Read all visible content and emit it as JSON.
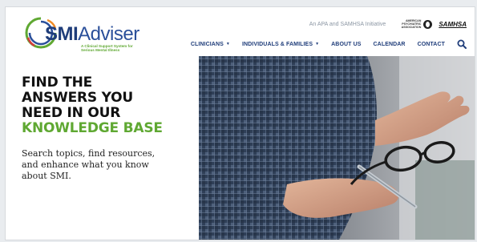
{
  "logo": {
    "smi": "SMI",
    "adviser": "Adviser",
    "tagline": "A Clinical Support System for Serious Mental Illness"
  },
  "header": {
    "initiative": "An APA and SAMHSA Initiative",
    "apa_text": "AMERICAN PSYCHIATRIC ASSOCIATION",
    "samhsa": "SAMHSA"
  },
  "nav": {
    "items": [
      {
        "label": "CLINICIANS",
        "dropdown": true
      },
      {
        "label": "INDIVIDUALS & FAMILIES",
        "dropdown": true
      },
      {
        "label": "ABOUT US",
        "dropdown": false
      },
      {
        "label": "CALENDAR",
        "dropdown": false
      },
      {
        "label": "CONTACT",
        "dropdown": false
      }
    ],
    "search_icon": "search-icon"
  },
  "hero": {
    "headline_lines": [
      "FIND THE",
      "ANSWERS YOU",
      "NEED IN OUR"
    ],
    "headline_highlight": "KNOWLEDGE BASE",
    "subtext": "Search topics, find resources, and enhance what you know about SMI."
  },
  "colors": {
    "brand_blue": "#1f3d7a",
    "brand_green": "#5fa832",
    "text_dark": "#111111",
    "muted": "#8b96a3"
  }
}
